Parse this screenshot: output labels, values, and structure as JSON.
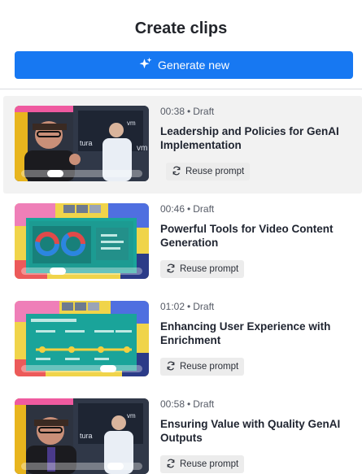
{
  "header": {
    "title": "Create clips"
  },
  "generate": {
    "label": "Generate new",
    "icon": "sparkle-icon",
    "color": "#1778f2"
  },
  "reuse_label": "Reuse prompt",
  "clips": [
    {
      "duration": "00:38",
      "status": "Draft",
      "title": "Leadership and Policies for GenAI Implementation",
      "scrub": 0.28
    },
    {
      "duration": "00:46",
      "status": "Draft",
      "title": "Powerful Tools for Video Content Generation",
      "scrub": 0.3
    },
    {
      "duration": "01:02",
      "status": "Draft",
      "title": "Enhancing User Experience with Enrichment",
      "scrub": 0.72
    },
    {
      "duration": "00:58",
      "status": "Draft",
      "title": "Ensuring Value with Quality GenAI Outputs",
      "scrub": 0.78
    }
  ]
}
